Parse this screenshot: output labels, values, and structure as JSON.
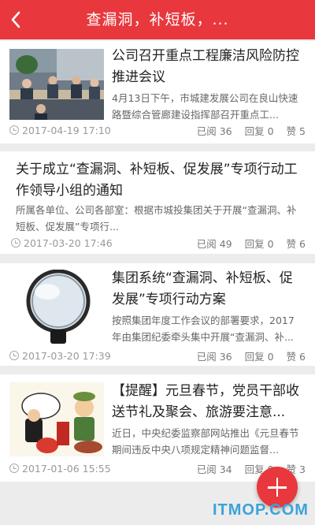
{
  "header": {
    "title": "查漏洞，补短板，...",
    "back_icon": "chevron-left-icon"
  },
  "articles": [
    {
      "title": "公司召开重点工程廉洁风险防控推进会议",
      "summary": "4月13日下午，市城建发展公司在良山快速路暨综合管廊建设指挥部召开重点工...",
      "date": "2017-04-19 17:10",
      "read": "已阅 36",
      "reply": "回复 0",
      "like": "赞 5"
    },
    {
      "title": "关于成立“查漏洞、补短板、促发展”专项行动工作领导小组的通知",
      "summary": "所属各单位、公司各部室：根据市城投集团关于开展“查漏洞、补短板、促发展”专项行...",
      "date": "2017-03-20 17:46",
      "read": "已阅 49",
      "reply": "回复 0",
      "like": "赞 6"
    },
    {
      "title": "集团系统“查漏洞、补短板、促发展”专项行动方案",
      "summary": "按照集团年度工作会议的部署要求，2017年由集团纪委牵头集中开展“查漏洞、补...",
      "date": "2017-03-20 17:39",
      "read": "已阅 36",
      "reply": "回复 0",
      "like": "赞 6"
    },
    {
      "title": "【提醒】元旦春节，党员干部收送节礼及聚会、旅游要注意...",
      "summary": "近日，中央纪委监察部网站推出《元旦春节期间违反中央八项规定精神问题监督...",
      "date": "2017-01-06 15:55",
      "read": "已阅 34",
      "reply": "回复 0",
      "like": "赞 3"
    }
  ],
  "fab": {
    "icon": "plus-icon"
  },
  "watermark": "ITMOP.COM",
  "colors": {
    "accent": "#e8383d",
    "background": "#ececec"
  }
}
